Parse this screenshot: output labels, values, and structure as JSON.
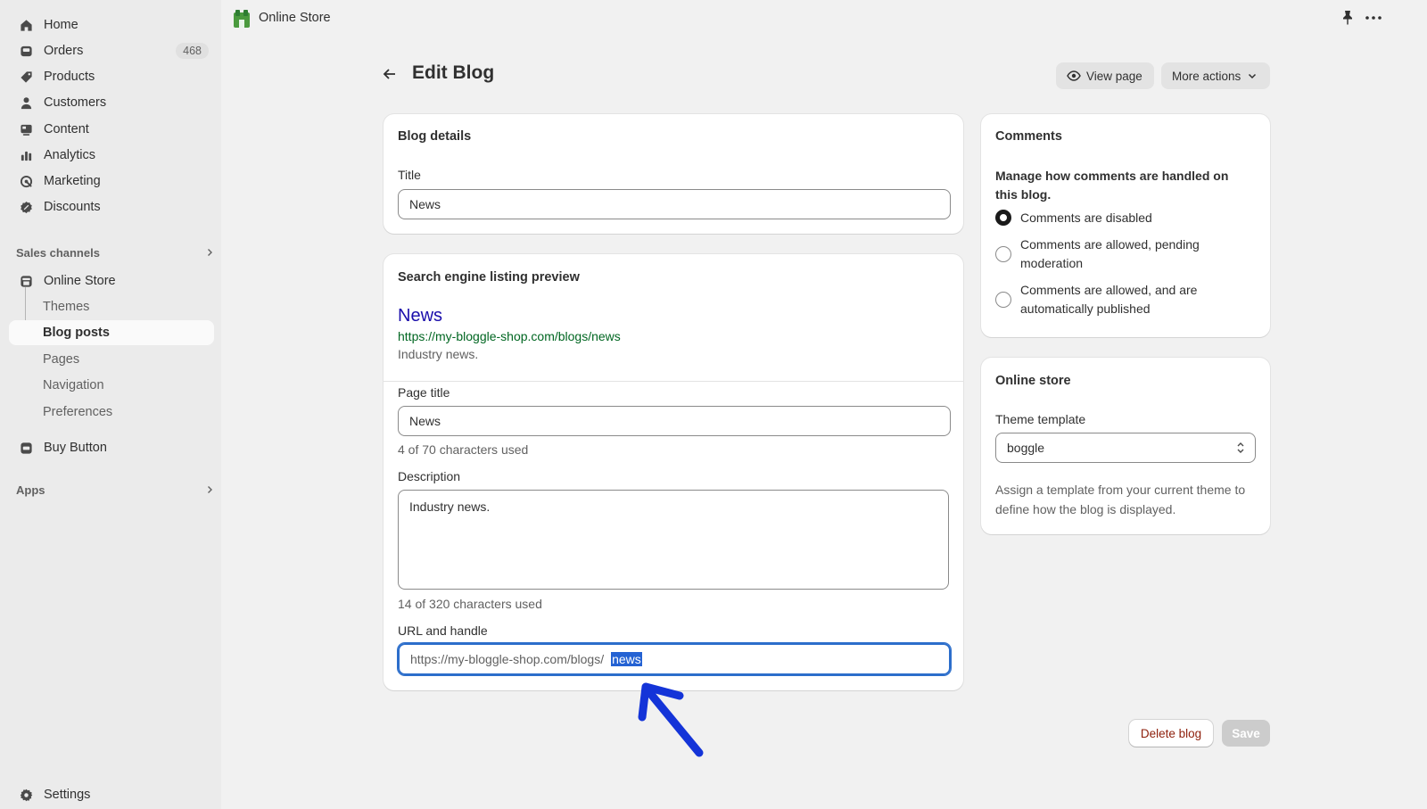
{
  "sidebar": {
    "main_items": [
      {
        "label": "Home",
        "icon": "home-icon"
      },
      {
        "label": "Orders",
        "icon": "orders-icon",
        "badge": "468"
      },
      {
        "label": "Products",
        "icon": "tag-icon"
      },
      {
        "label": "Customers",
        "icon": "person-icon"
      },
      {
        "label": "Content",
        "icon": "content-icon"
      },
      {
        "label": "Analytics",
        "icon": "bar-chart-icon"
      },
      {
        "label": "Marketing",
        "icon": "target-icon"
      },
      {
        "label": "Discounts",
        "icon": "discount-icon"
      }
    ],
    "sales_channels_label": "Sales channels",
    "online_store": {
      "label": "Online Store",
      "icon": "store-icon"
    },
    "online_store_sub": [
      "Themes",
      "Blog posts",
      "Pages",
      "Navigation",
      "Preferences"
    ],
    "active_sub": "Blog posts",
    "buy_button": {
      "label": "Buy Button",
      "icon": "buy-button-icon"
    },
    "apps_label": "Apps",
    "settings": {
      "label": "Settings",
      "icon": "gear-icon"
    }
  },
  "topbar": {
    "title": "Online Store"
  },
  "header": {
    "title": "Edit Blog",
    "view_page": "View page",
    "more_actions": "More actions"
  },
  "blog_details": {
    "heading": "Blog details",
    "title_label": "Title",
    "title_value": "News"
  },
  "seo": {
    "heading": "Search engine listing preview",
    "preview_title": "News",
    "preview_url": "https://my-bloggle-shop.com/blogs/news",
    "preview_description": "Industry news.",
    "page_title_label": "Page title",
    "page_title_value": "News",
    "page_title_help": "4 of 70 characters used",
    "description_label": "Description",
    "description_value": "Industry news.",
    "description_help": "14 of 320 characters used",
    "url_label": "URL and handle",
    "url_prefix": "https://my-bloggle-shop.com/blogs/",
    "url_handle": "news"
  },
  "comments": {
    "heading": "Comments",
    "description": "Manage how comments are handled on this blog.",
    "options": [
      {
        "label": "Comments are disabled",
        "checked": true
      },
      {
        "label": "Comments are allowed, pending moderation",
        "checked": false
      },
      {
        "label": "Comments are allowed, and are automatically published",
        "checked": false
      }
    ]
  },
  "online_store_card": {
    "heading": "Online store",
    "template_label": "Theme template",
    "template_value": "boggle",
    "help": "Assign a template from your current theme to define how the blog is displayed."
  },
  "footer": {
    "delete_label": "Delete blog",
    "save_label": "Save"
  },
  "colors": {
    "accent": "#2c6ecb",
    "annotation_arrow": "#1434d8",
    "link_title": "#1a0dab",
    "link_url": "#006621",
    "destructive": "#8e1f0b"
  }
}
